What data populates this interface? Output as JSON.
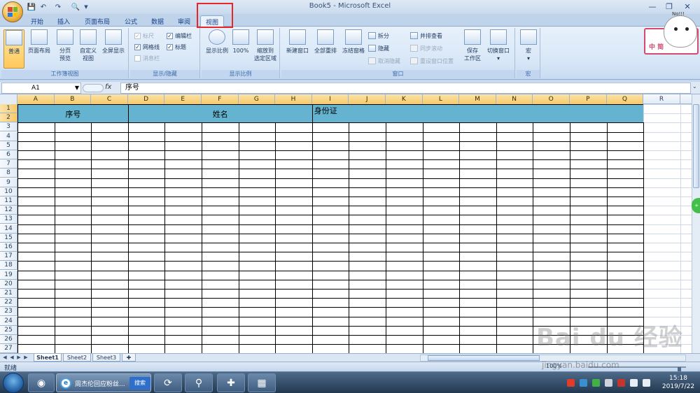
{
  "window": {
    "title": "Book5 - Microsoft Excel",
    "quick_access": [
      "save-icon",
      "undo-icon",
      "redo-icon",
      "print-preview-icon"
    ],
    "controls": [
      "minimize",
      "restore",
      "close"
    ]
  },
  "tabs": [
    {
      "label": "开始",
      "active": false
    },
    {
      "label": "插入",
      "active": false
    },
    {
      "label": "页面布局",
      "active": false
    },
    {
      "label": "公式",
      "active": false
    },
    {
      "label": "数据",
      "active": false
    },
    {
      "label": "审阅",
      "active": false
    },
    {
      "label": "视图",
      "active": true
    }
  ],
  "ribbon": {
    "workbook_views": {
      "label": "工作簿视图",
      "normal": "普通",
      "page_layout": "页面布局",
      "page_break_1": "分页",
      "page_break_2": "预览",
      "custom_1": "自定义",
      "custom_2": "视图",
      "fullscreen": "全屏显示"
    },
    "show_hide": {
      "label": "显示/隐藏",
      "ruler": "标尺",
      "gridlines": "网格线",
      "message_bar": "消息栏",
      "formula_bar": "编辑栏",
      "headings": "标题"
    },
    "zoom": {
      "label": "显示比例",
      "zoom": "显示比例",
      "hundred": "100%",
      "zoom_sel_1": "缩放到",
      "zoom_sel_2": "选定区域"
    },
    "window": {
      "label": "窗口",
      "new_window": "新建窗口",
      "arrange_all": "全部重排",
      "freeze": "冻结窗格",
      "split": "拆分",
      "hide": "隐藏",
      "unhide": "取消隐藏",
      "side_by_side": "并排查看",
      "sync_scroll": "同步滚动",
      "reset_position": "重设窗口位置",
      "save_ws_1": "保存",
      "save_ws_2": "工作区",
      "switch_1": "切换窗口"
    },
    "macros": {
      "label": "宏",
      "macros": "宏"
    }
  },
  "sticker": {
    "text": "中 简",
    "caption": "No!!!"
  },
  "formula_bar": {
    "name_box": "A1",
    "fx": "fx",
    "content": "序号"
  },
  "columns": [
    "A",
    "B",
    "C",
    "D",
    "E",
    "F",
    "G",
    "H",
    "I",
    "J",
    "K",
    "L",
    "M",
    "N",
    "O",
    "P",
    "Q",
    "R"
  ],
  "rows": [
    "1",
    "2",
    "3",
    "4",
    "5",
    "6",
    "7",
    "8",
    "9",
    "10",
    "11",
    "12",
    "13",
    "14",
    "15",
    "16",
    "17",
    "18",
    "19",
    "20",
    "21",
    "22",
    "23",
    "24",
    "25",
    "26",
    "27"
  ],
  "headers": {
    "seq": "序号",
    "name": "姓名",
    "id": "身份证"
  },
  "sheets": [
    {
      "label": "Sheet1",
      "active": true
    },
    {
      "label": "Sheet2",
      "active": false
    },
    {
      "label": "Sheet3",
      "active": false
    }
  ],
  "status": {
    "ready": "就绪",
    "zoom": "100%"
  },
  "taskbar": {
    "browser_text": "周杰伦回应粉丝...",
    "browser_search": "搜索",
    "time": "15:18",
    "date": "2019/7/22"
  },
  "watermark": {
    "brand": "Bai du 经验",
    "url": "jingyan.baidu.com"
  },
  "colors": {
    "header_fill": "#64b4d1",
    "tab_highlight": "#e8262a",
    "ribbon_bg": "#d7e6f7"
  }
}
